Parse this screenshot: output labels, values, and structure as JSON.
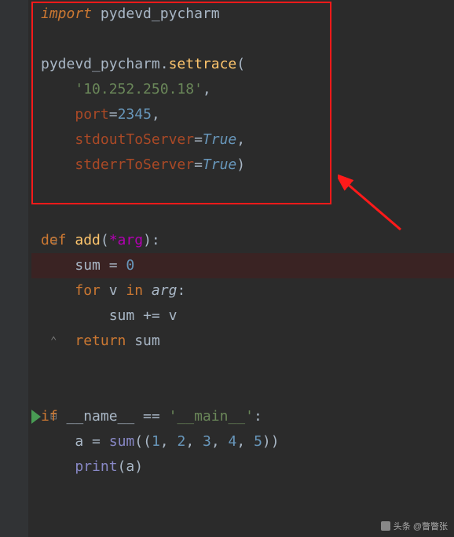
{
  "code": {
    "line1_import": "import",
    "line1_module": " pydevd_pycharm",
    "line3_obj": "pydevd_pycharm",
    "line3_dot": ".",
    "line3_method": "settrace",
    "line3_paren": "(",
    "line4_str": "'10.252.250.18'",
    "line4_comma": ",",
    "line5_param": "port",
    "line5_eq": "=",
    "line5_num": "2345",
    "line5_comma": ",",
    "line6_param": "stdoutToServer",
    "line6_eq": "=",
    "line6_bool": "True",
    "line6_comma": ",",
    "line7_param": "stderrToServer",
    "line7_eq": "=",
    "line7_bool": "True",
    "line7_close": ")",
    "line10_def": "def ",
    "line10_name": "add",
    "line10_open": "(",
    "line10_star": "*arg",
    "line10_close": "):",
    "line11_var": "sum ",
    "line11_eq": "= ",
    "line11_num": "0",
    "line12_for": "for ",
    "line12_v": "v ",
    "line12_in": "in ",
    "line12_arg": "arg",
    "line12_colon": ":",
    "line13_var": "sum ",
    "line13_op": "+= ",
    "line13_v": "v",
    "line14_ret": "return ",
    "line14_var": "sum",
    "line17_if": "if ",
    "line17_name": "__name__",
    "line17_eq": " == ",
    "line17_str": "'__main__'",
    "line17_colon": ":",
    "line18_a": "a ",
    "line18_eq": "= ",
    "line18_sum": "sum",
    "line18_open": "((",
    "line18_n1": "1",
    "line18_c1": ", ",
    "line18_n2": "2",
    "line18_c2": ", ",
    "line18_n3": "3",
    "line18_c3": ", ",
    "line18_n4": "4",
    "line18_c4": ", ",
    "line18_n5": "5",
    "line18_close": "))",
    "line19_print": "print",
    "line19_open": "(",
    "line19_a": "a",
    "line19_close": ")"
  },
  "watermark": "头条 @瞥瞥张"
}
